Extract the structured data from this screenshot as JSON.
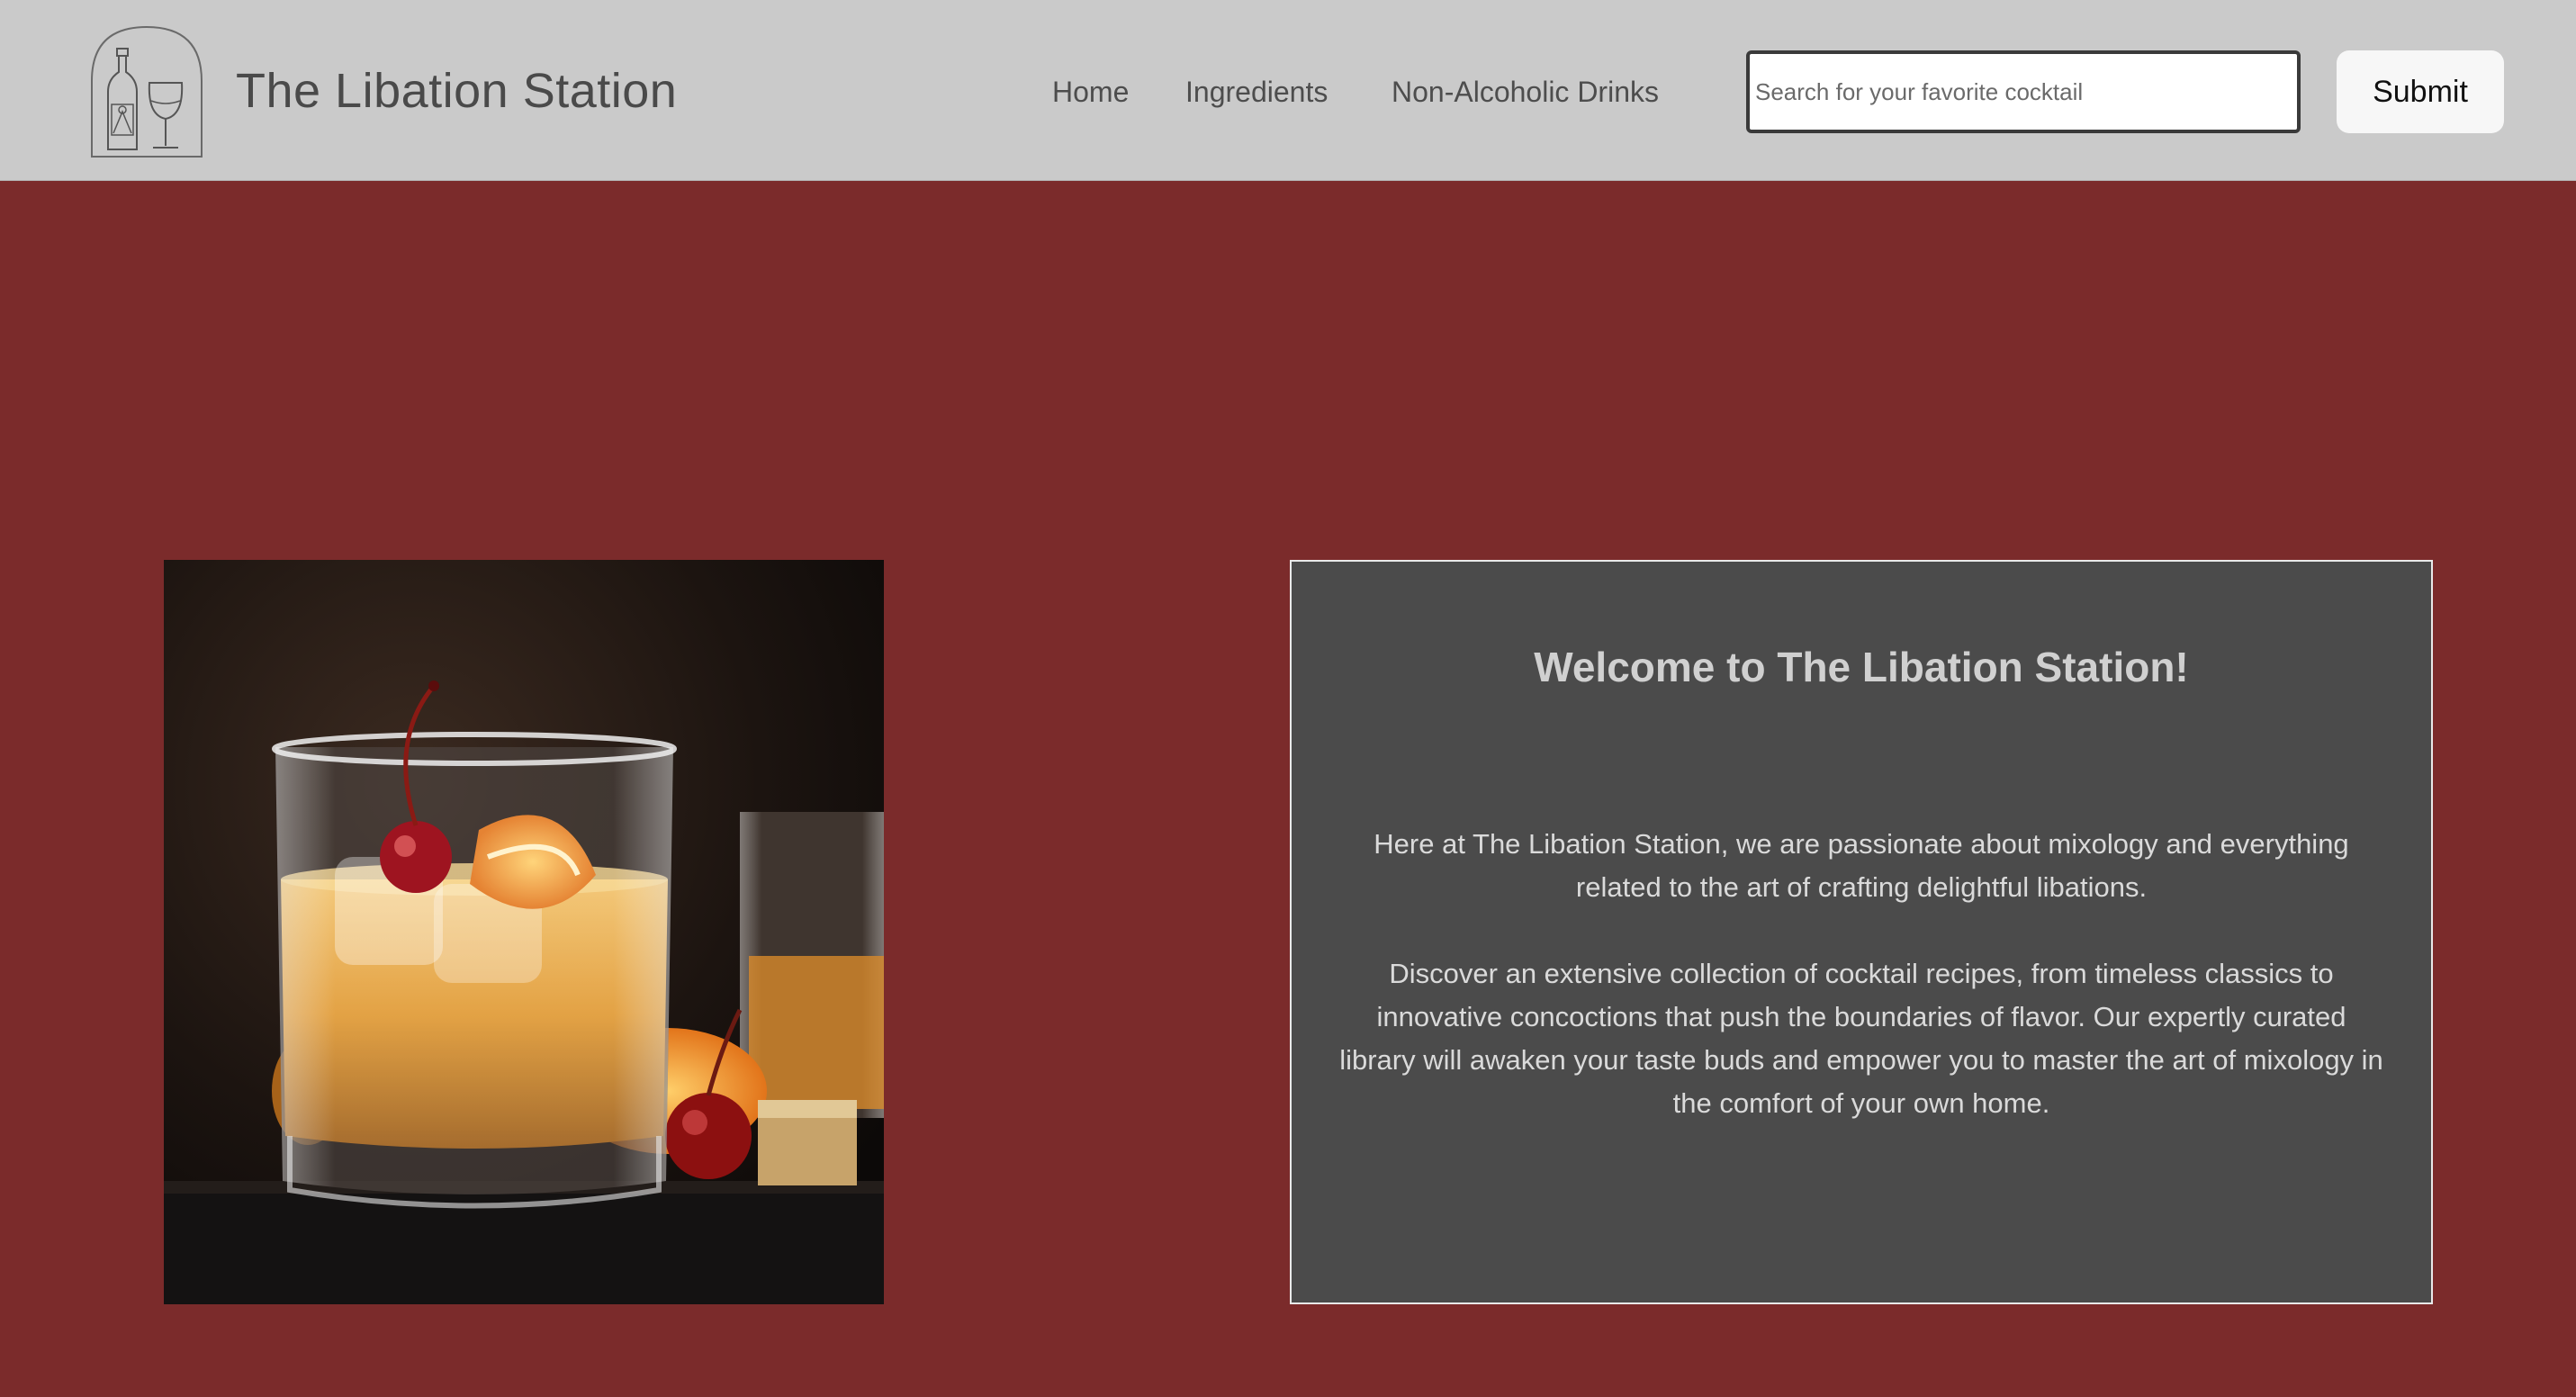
{
  "header": {
    "site_title": "The Libation Station",
    "logo_icon": "bottle-and-wine-glass-icon",
    "nav": {
      "home": "Home",
      "ingredients": "Ingredients",
      "non_alcoholic": "Non-Alcoholic Drinks"
    },
    "search": {
      "placeholder": "Search for your favorite cocktail",
      "value": ""
    },
    "submit_label": "Submit"
  },
  "main": {
    "hero_image": "old-fashioned-cocktail-photo",
    "welcome": {
      "title": "Welcome to The Libation Station!",
      "paragraph_1": "Here at The Libation Station, we are passionate about mixology and everything related to the art of crafting delightful libations.",
      "paragraph_2": "Discover an extensive collection of cocktail recipes, from timeless classics to innovative concoctions that push the boundaries of flavor. Our expertly curated library will awaken your taste buds and empower you to master the art of mixology in the comfort of your own home."
    }
  },
  "colors": {
    "header_bg": "#cacaca",
    "page_bg": "#7b2b2b",
    "panel_bg": "#4b4b4b"
  }
}
